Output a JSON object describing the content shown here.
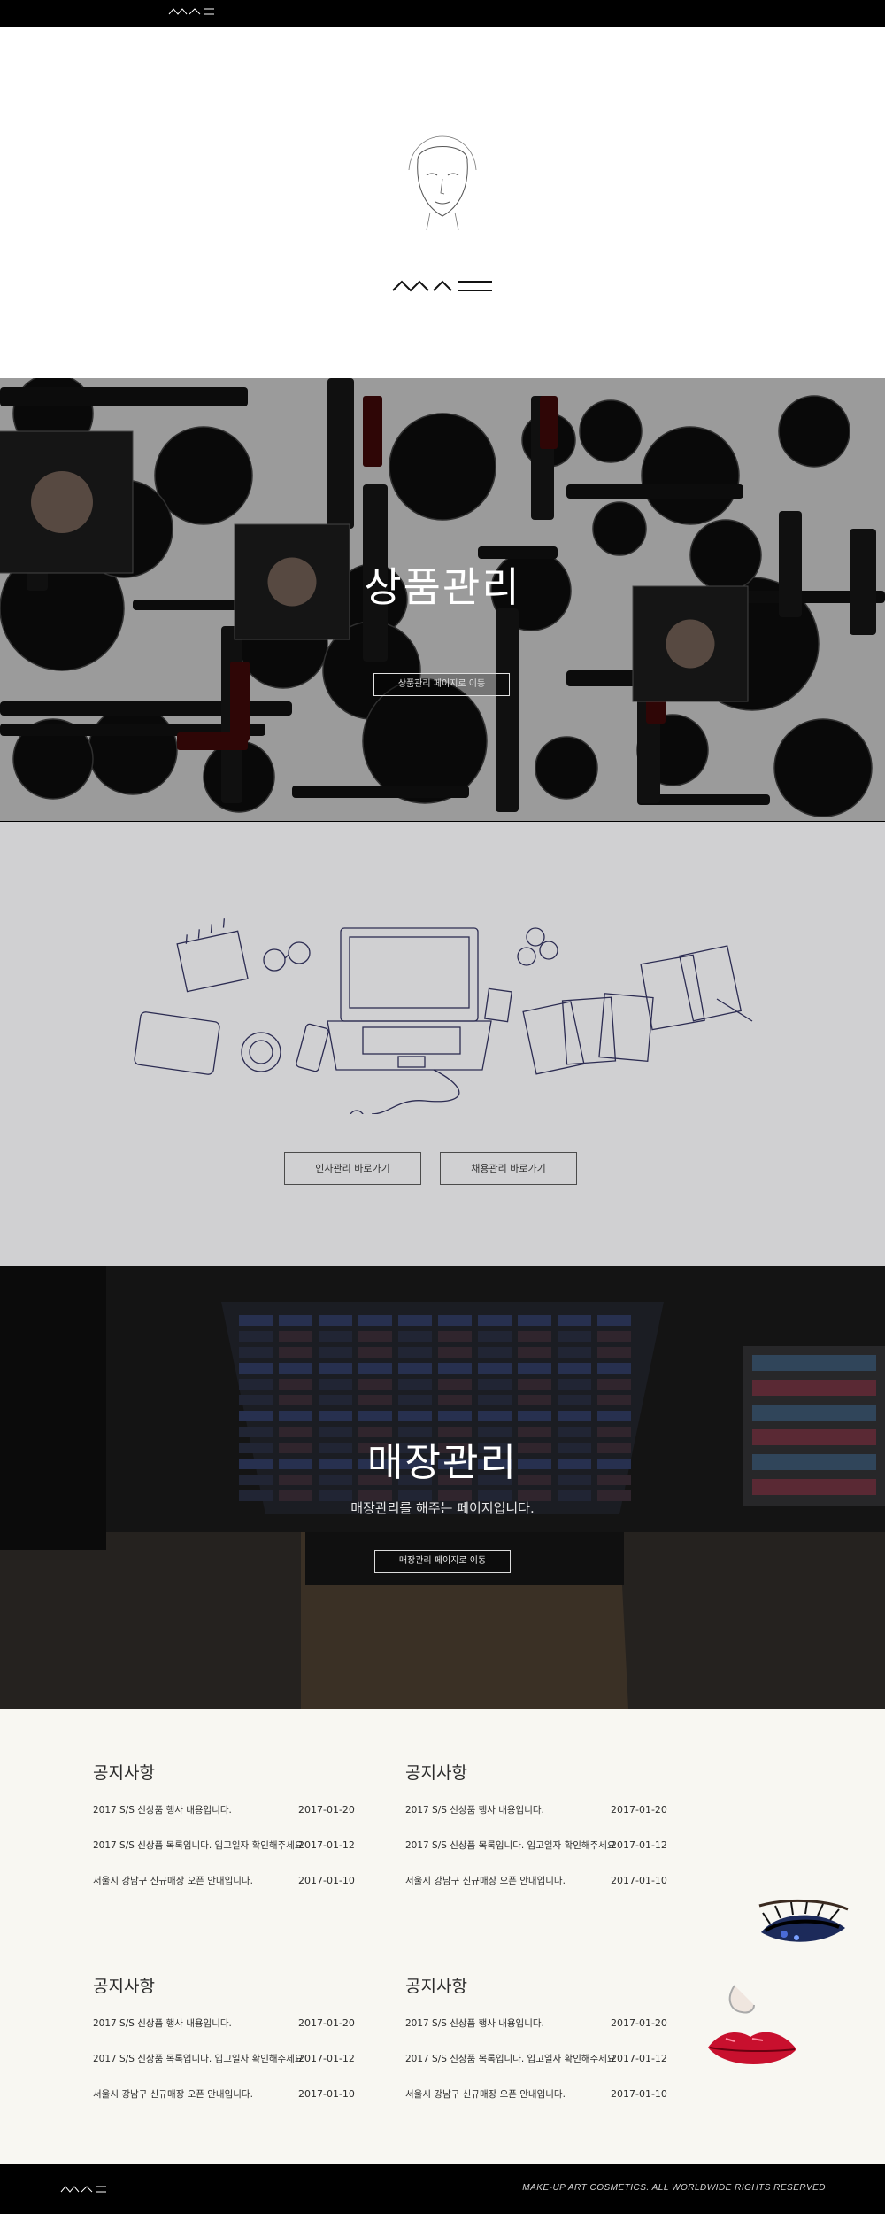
{
  "brand": {
    "logo_text": "MAC"
  },
  "product_section": {
    "title": "상품관리",
    "button_label": "상품관리 페이지로 이동"
  },
  "office_section": {
    "hr_button_label": "인사관리 바로가기",
    "recruit_button_label": "채용관리 바로가기"
  },
  "store_section": {
    "title": "매장관리",
    "subtitle": "매장관리를 해주는 페이지입니다.",
    "button_label": "매장관리 페이지로 이동"
  },
  "notices": [
    {
      "heading": "공지사항",
      "items": [
        {
          "title": "2017 S/S 신상품 행사 내용입니다.",
          "date": "2017-01-20"
        },
        {
          "title": "2017 S/S 신상품 목록입니다. 입고일자 확인해주세요",
          "date": "2017-01-12"
        },
        {
          "title": "서울시 강남구 신규매장 오픈 안내입니다.",
          "date": "2017-01-10"
        }
      ]
    },
    {
      "heading": "공지사항",
      "items": [
        {
          "title": "2017 S/S 신상품 행사 내용입니다.",
          "date": "2017-01-20"
        },
        {
          "title": "2017 S/S 신상품 목록입니다. 입고일자 확인해주세요",
          "date": "2017-01-12"
        },
        {
          "title": "서울시 강남구 신규매장 오픈 안내입니다.",
          "date": "2017-01-10"
        }
      ]
    },
    {
      "heading": "공지사항",
      "items": [
        {
          "title": "2017 S/S 신상품 행사 내용입니다.",
          "date": "2017-01-20"
        },
        {
          "title": "2017 S/S 신상품 목록입니다. 입고일자 확인해주세요",
          "date": "2017-01-12"
        },
        {
          "title": "서울시 강남구 신규매장 오픈 안내입니다.",
          "date": "2017-01-10"
        }
      ]
    },
    {
      "heading": "공지사항",
      "items": [
        {
          "title": "2017 S/S 신상품 행사 내용입니다.",
          "date": "2017-01-20"
        },
        {
          "title": "2017 S/S 신상품 목록입니다. 입고일자 확인해주세요",
          "date": "2017-01-12"
        },
        {
          "title": "서울시 강남구 신규매장 오픈 안내입니다.",
          "date": "2017-01-10"
        }
      ]
    }
  ],
  "footer": {
    "copyright": "MAKE-UP ART COSMETICS. ALL WORLDWIDE RIGHTS RESERVED"
  },
  "colors": {
    "header_bg": "#000000",
    "hero_bg": "#ffffff",
    "office_bg": "#d0d0d2",
    "notices_bg": "#f8f7f2",
    "accent_lips": "#c8102e"
  }
}
